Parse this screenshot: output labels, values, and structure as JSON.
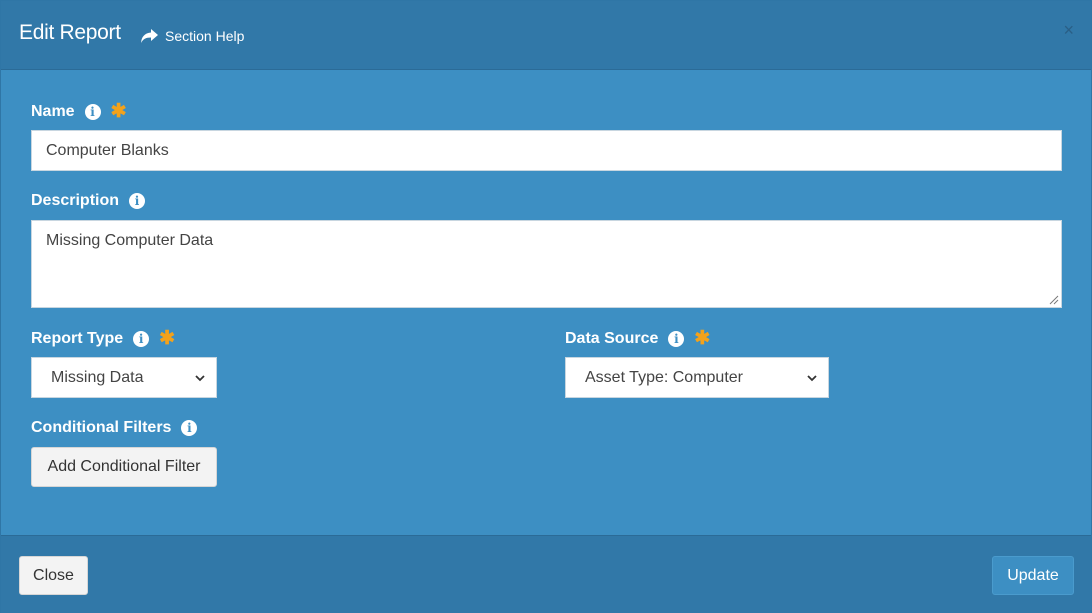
{
  "header": {
    "title": "Edit Report",
    "section_help_label": "Section Help",
    "close_symbol": "×"
  },
  "form": {
    "name": {
      "label": "Name",
      "value": "Computer Blanks",
      "required": true
    },
    "description": {
      "label": "Description",
      "value": "Missing Computer Data"
    },
    "report_type": {
      "label": "Report Type",
      "selected": "Missing Data",
      "required": true
    },
    "data_source": {
      "label": "Data Source",
      "selected": "Asset Type: Computer",
      "required": true
    },
    "conditional_filters": {
      "label": "Conditional Filters",
      "add_button_label": "Add Conditional Filter"
    }
  },
  "footer": {
    "close_label": "Close",
    "update_label": "Update"
  },
  "icons": {
    "info": "info-icon",
    "required": "asterisk-icon",
    "section_help": "share-arrow-icon",
    "dropdown": "chevron-down-icon"
  },
  "colors": {
    "body_bg": "#3d8fc3",
    "header_bg": "#3178a8",
    "required_asterisk": "#f3a21b"
  }
}
